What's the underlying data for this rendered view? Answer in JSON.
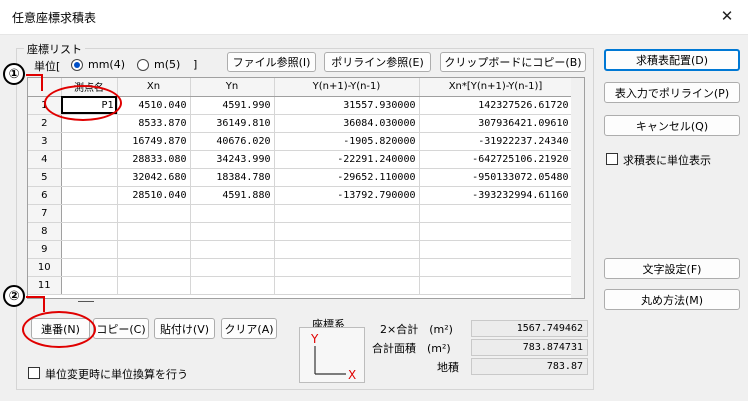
{
  "window": {
    "title": "任意座標求積表",
    "close_glyph": "✕"
  },
  "list_group": {
    "label": "座標リスト"
  },
  "units": {
    "label": "単位[",
    "close_bracket": "]",
    "options": [
      {
        "label": "mm(4)",
        "selected": true
      },
      {
        "label": "m(5)",
        "selected": false
      }
    ]
  },
  "toolbar": {
    "file_ref": "ファイル参照(I)",
    "polyline_ref": "ポリライン参照(E)",
    "copy_clipboard": "クリップボードにコピー(B)"
  },
  "table": {
    "columns": [
      "測点名",
      "Xn",
      "Yn",
      "Y(n+1)-Y(n-1)",
      "Xn*[Y(n+1)-Y(n-1)]"
    ],
    "rows": [
      {
        "no": "1",
        "name": "P1",
        "xn": "4510.040",
        "yn": "4591.990",
        "dy": "31557.930000",
        "prod": "142327526.61720"
      },
      {
        "no": "2",
        "name": "",
        "xn": "8533.870",
        "yn": "36149.810",
        "dy": "36084.030000",
        "prod": "307936421.09610"
      },
      {
        "no": "3",
        "name": "",
        "xn": "16749.870",
        "yn": "40676.020",
        "dy": "-1905.820000",
        "prod": "-31922237.24340"
      },
      {
        "no": "4",
        "name": "",
        "xn": "28833.080",
        "yn": "34243.990",
        "dy": "-22291.240000",
        "prod": "-642725106.21920"
      },
      {
        "no": "5",
        "name": "",
        "xn": "32042.680",
        "yn": "18384.780",
        "dy": "-29652.110000",
        "prod": "-950133072.05480"
      },
      {
        "no": "6",
        "name": "",
        "xn": "28510.040",
        "yn": "4591.880",
        "dy": "-13792.790000",
        "prod": "-393232994.61160"
      },
      {
        "no": "7",
        "name": "",
        "xn": "",
        "yn": "",
        "dy": "",
        "prod": ""
      },
      {
        "no": "8",
        "name": "",
        "xn": "",
        "yn": "",
        "dy": "",
        "prod": ""
      },
      {
        "no": "9",
        "name": "",
        "xn": "",
        "yn": "",
        "dy": "",
        "prod": ""
      },
      {
        "no": "10",
        "name": "",
        "xn": "",
        "yn": "",
        "dy": "",
        "prod": ""
      },
      {
        "no": "11",
        "name": "",
        "xn": "",
        "yn": "",
        "dy": "",
        "prod": ""
      }
    ]
  },
  "bottom_buttons": {
    "renban": "連番(N)",
    "copy": "コピー(C)",
    "paste": "貼付け(V)",
    "clear": "クリア(A)"
  },
  "coord_system": {
    "label": "座標系",
    "y_axis": "Y",
    "x_axis": "X"
  },
  "results": {
    "double_sum_label": "2×合計　(m²)",
    "double_sum_value": "1567.749462",
    "area_label": "合計面積　(m²)",
    "area_value": "783.874731",
    "land_label": "地積",
    "land_value": "783.87"
  },
  "unit_convert_option": {
    "label": "単位変更時に単位換算を行う",
    "checked": false
  },
  "right_panel": {
    "place_table": "求積表配置(D)",
    "polyline_from_table": "表入力でポリライン(P)",
    "cancel": "キャンセル(Q)",
    "show_units": {
      "label": "求積表に単位表示",
      "checked": false
    },
    "text_settings": "文字設定(F)",
    "rounding": "丸め方法(M)"
  },
  "annotations": {
    "marker1": "①",
    "marker2": "②"
  },
  "colors": {
    "annotation": "#e00000",
    "focus_border": "#0078d4"
  }
}
